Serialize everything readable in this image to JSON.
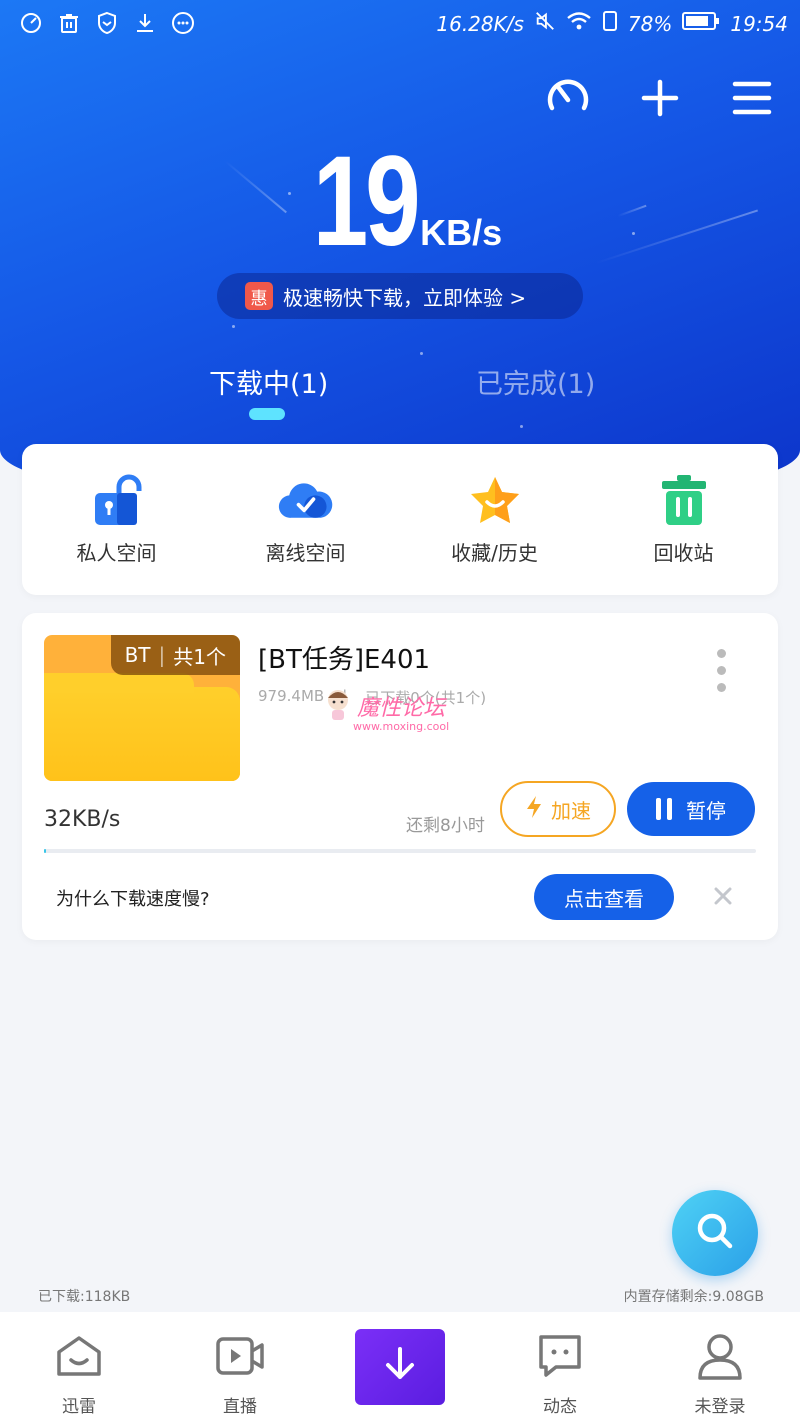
{
  "status_bar": {
    "net_speed": "16.28K/s",
    "battery_percent": "78%",
    "time": "19:54"
  },
  "header": {
    "speed_value": "19",
    "speed_unit": "KB/s",
    "promo_badge": "惠",
    "promo_text": "极速畅快下载，立即体验 >"
  },
  "tabs": [
    {
      "label": "下载中(1)",
      "active": true
    },
    {
      "label": "已完成(1)",
      "active": false
    }
  ],
  "quick_actions": [
    {
      "label": "私人空间",
      "icon": "lock-icon"
    },
    {
      "label": "离线空间",
      "icon": "cloud-check-icon"
    },
    {
      "label": "收藏/历史",
      "icon": "star-icon"
    },
    {
      "label": "回收站",
      "icon": "trash-icon"
    }
  ],
  "task": {
    "tag_bt": "BT",
    "tag_count": "共1个",
    "title": "[BT任务]E401",
    "size": "979.4MB",
    "files_progress": "已下载0个(共1个)",
    "speed": "32KB/s",
    "remaining": "还剩8小时",
    "accelerate_label": "加速",
    "pause_label": "暂停",
    "progress_fraction": 0.003,
    "slow_question": "为什么下载速度慢?",
    "check_label": "点击查看"
  },
  "watermark": {
    "text": "魔性论坛",
    "url": "www.moxing.cool"
  },
  "footer": {
    "downloaded": "已下载:118KB",
    "storage": "内置存储剩余:9.08GB"
  },
  "bottom_nav": [
    {
      "label": "迅雷",
      "icon": "home-icon"
    },
    {
      "label": "直播",
      "icon": "video-icon"
    },
    {
      "label": "",
      "icon": "download-icon"
    },
    {
      "label": "动态",
      "icon": "chat-icon"
    },
    {
      "label": "未登录",
      "icon": "user-icon"
    }
  ],
  "colors": {
    "primary_blue": "#1561e8",
    "accent_orange": "#f5a623",
    "accent_purple": "#6a26ee"
  }
}
